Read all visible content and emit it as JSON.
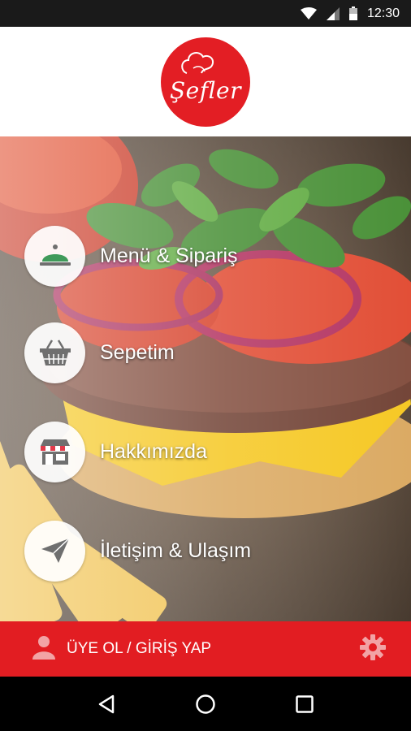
{
  "status_bar": {
    "time": "12:30",
    "icons": [
      "wifi-icon",
      "signal-icon",
      "battery-icon"
    ]
  },
  "header": {
    "logo_text": "Şefler",
    "brand_color": "#e31e24"
  },
  "menu": {
    "items": [
      {
        "label": "Menü & Sipariş",
        "icon": "food-cloche-icon"
      },
      {
        "label": "Sepetim",
        "icon": "basket-icon"
      },
      {
        "label": "Hakkımızda",
        "icon": "storefront-icon"
      },
      {
        "label": "İletişim & Ulaşım",
        "icon": "paper-plane-icon"
      }
    ]
  },
  "bottom_bar": {
    "login_label": "ÜYE OL / GİRİŞ YAP",
    "login_icon": "user-icon",
    "settings_icon": "gear-icon",
    "bar_color": "#e21d22"
  },
  "nav_bar": {
    "icons": [
      "back-icon",
      "home-icon",
      "recents-icon"
    ]
  }
}
